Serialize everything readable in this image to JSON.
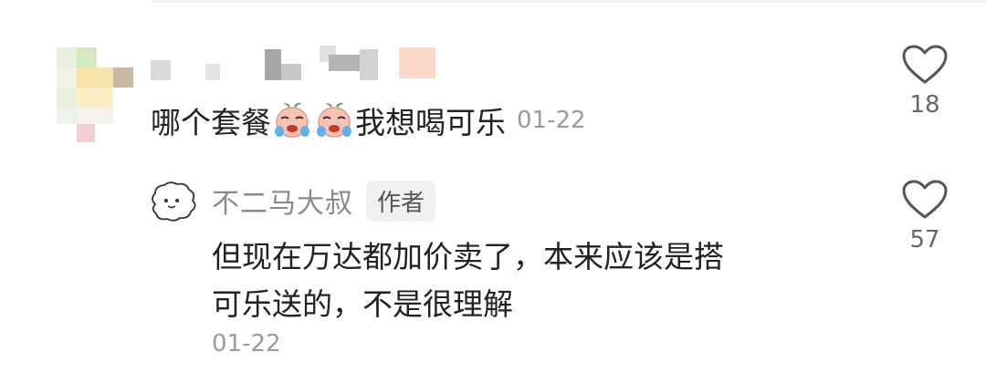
{
  "comment": {
    "text_part1": "哪个套餐",
    "emojis": [
      "crying-face-emoji",
      "crying-face-emoji"
    ],
    "text_part2": "我想喝可乐",
    "date": "01-22",
    "likes": "18"
  },
  "reply": {
    "author": "不二马大叔",
    "badge": "作者",
    "lines": [
      "但现在万达都加价卖了，本来应该是搭",
      "可乐送的，不是很理解"
    ],
    "date": "01-22",
    "likes": "57"
  },
  "icons": {
    "like": "heart-outline-icon"
  },
  "colors": {
    "text": "#222222",
    "secondary": "#9a9a9a",
    "author_name": "#8a8a8a",
    "badge_bg": "#f0f0f0"
  }
}
